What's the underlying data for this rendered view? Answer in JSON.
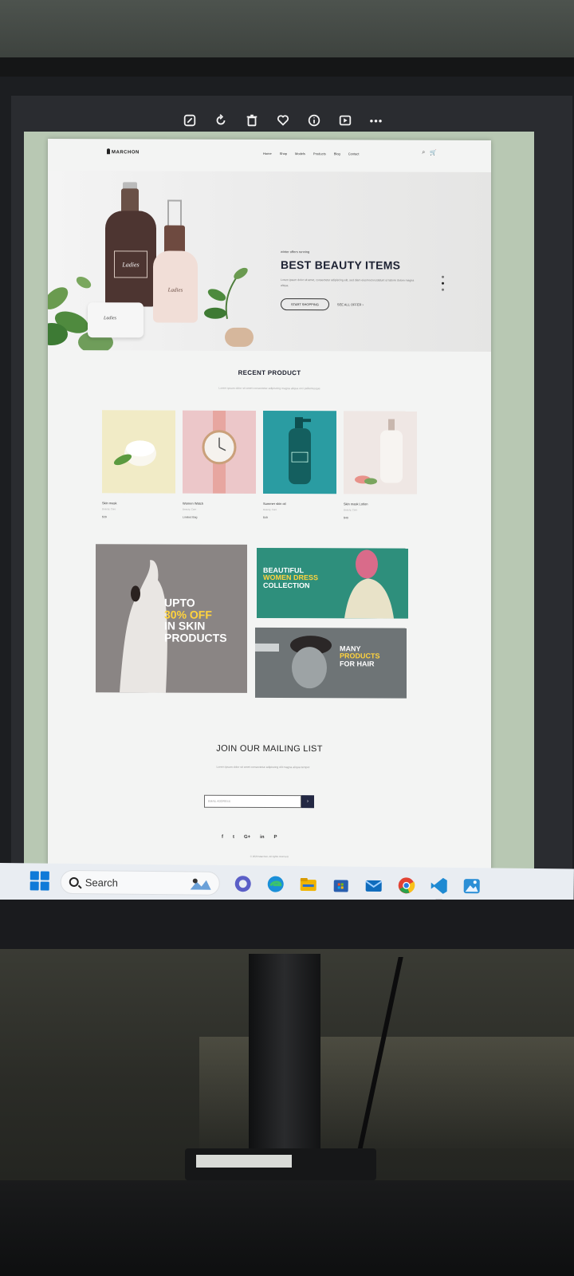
{
  "viewer": {
    "toolbar": {
      "edit_icon": "edit-icon",
      "rotate_icon": "rotate-icon",
      "delete_icon": "trash-icon",
      "favorite_icon": "heart-icon",
      "info_icon": "info-icon",
      "slideshow_icon": "slideshow-icon",
      "more_icon": "more-icon",
      "more_glyph": "•••"
    }
  },
  "site": {
    "logo": "MARCHON",
    "nav": [
      "Home",
      "Shop",
      "Models",
      "Products",
      "Blog",
      "Contact"
    ],
    "header_icons": [
      "⌕",
      "🛒"
    ],
    "hero": {
      "kicker": "winter offers running",
      "title": "BEST BEAUTY ITEMS",
      "description": "Lorem ipsum dolor sit amet, consectetur adipiscing elit, sed diam eiusmod incididunt ut labore dolore magna aliqua.",
      "primary_button": "START SHOPPING",
      "secondary_link": "SEE ALL OFFER ›",
      "bottle_label": "Ladies",
      "slides": 3,
      "active_slide": 2
    },
    "recent": {
      "title": "RECENT PRODUCT",
      "subtitle": "Lorem ipsum dolor sit amet consectetur adipiscing magna aliqua orci pellentesque",
      "products": [
        {
          "name": "Skin mask",
          "category": "Beauty, Care",
          "price": "$39",
          "bg": "#f1ebc6"
        },
        {
          "name": "Women Watch",
          "category": "Beauty, Care",
          "price": "Limited Bag",
          "bg": "#ecc7c9"
        },
        {
          "name": "Summer skin oil",
          "category": "Beauty, Care",
          "price": "$49",
          "bg": "#2a9ca2"
        },
        {
          "name": "Skin mask Lotion",
          "category": "Beauty, Care",
          "price": "$49",
          "bg": "#efe7e4"
        }
      ]
    },
    "banners": {
      "skin": {
        "line1": "UPTO",
        "line2": "30% OFF",
        "line3": "IN SKIN",
        "line4": "PRODUCTS",
        "bg": "#8a8584"
      },
      "dress": {
        "line1": "BEAUTIFUL",
        "line2": "WOMEN DRESS",
        "line3": "COLLECTION",
        "bg": "#2e8f7c"
      },
      "hair": {
        "line1": "MANY",
        "line2": "PRODUCTS",
        "line3": "FOR HAIR",
        "bg": "#6e7476"
      }
    },
    "mailing": {
      "title": "JOIN OUR MAILING LIST",
      "subtitle": "Lorem ipsum dolor sit amet consectetur adipiscing elit magna aliqua tempor",
      "input_placeholder": "EMAIL ADDRESS",
      "submit_glyph": "›"
    },
    "social": [
      "f",
      "t",
      "G+",
      "in",
      "P"
    ],
    "copyright": "© 2023 Marchon. All rights reserved."
  },
  "taskbar": {
    "search_label": "Search",
    "apps": [
      {
        "name": "chat-app",
        "color": "#5b5fc7"
      },
      {
        "name": "edge-browser",
        "color": "#1a8fd8"
      },
      {
        "name": "file-explorer",
        "color": "#f0b400"
      },
      {
        "name": "store-app",
        "color": "#2a5fae"
      },
      {
        "name": "mail-app",
        "color": "#0f6cbd"
      },
      {
        "name": "chrome-browser",
        "color": "#e24333"
      },
      {
        "name": "vscode",
        "color": "#1f8ad2"
      },
      {
        "name": "photos-app",
        "color": "#2b8fd6"
      }
    ]
  }
}
